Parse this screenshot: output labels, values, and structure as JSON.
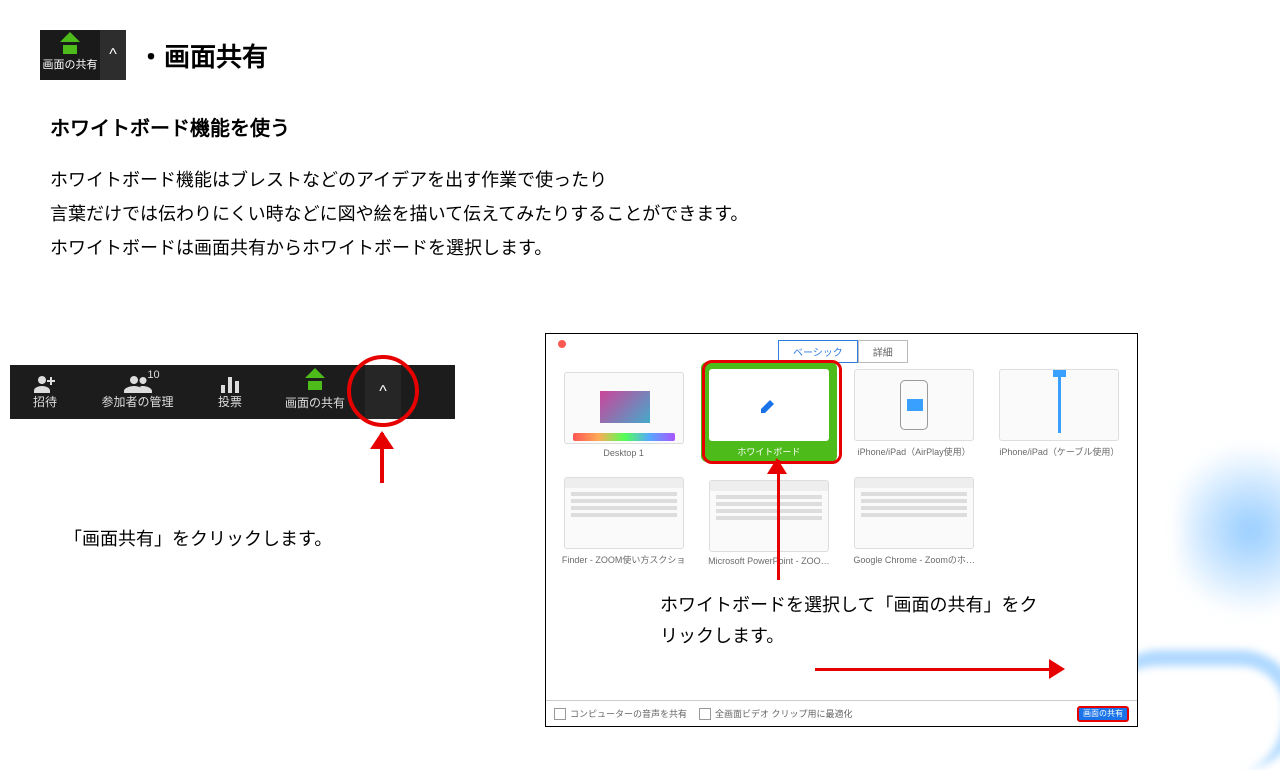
{
  "header": {
    "pill_label": "画面の共有",
    "caret": "^",
    "title": "・画面共有"
  },
  "subtitle": "ホワイトボード機能を使う",
  "body": "ホワイトボード機能はブレストなどのアイデアを出す作業で使ったり\n言葉だけでは伝わりにくい時などに図や絵を描いて伝えてみたりすることができます。\nホワイトボードは画面共有からホワイトボードを選択します。",
  "toolbar": {
    "invite": "招待",
    "participants": "参加者の管理",
    "participants_count": "10",
    "poll": "投票",
    "share": "画面の共有",
    "caret": "^"
  },
  "caption1": "「画面共有」をクリックします。",
  "dialog": {
    "tabs": {
      "basic": "ベーシック",
      "advanced": "詳細"
    },
    "tiles": {
      "desktop": "Desktop 1",
      "whiteboard": "ホワイトボード",
      "airplay": "iPhone/iPad（AirPlay使用）",
      "cable": "iPhone/iPad（ケーブル使用）",
      "finder": "Finder - ZOOM使い方スクショ",
      "ppt": "Microsoft PowerPoint - ZOO…",
      "chrome": "Google Chrome - Zoomのホ…"
    },
    "bottom": {
      "audio": "コンピューターの音声を共有",
      "optimize": "全画面ビデオ クリップ用に最適化",
      "share_btn": "画面の共有"
    }
  },
  "caption2": "ホワイトボードを選択して「画面の共有」をクリックします。"
}
